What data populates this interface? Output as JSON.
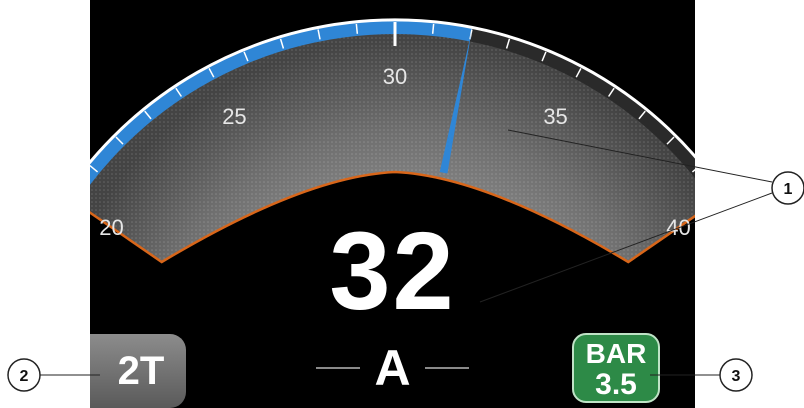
{
  "gauge": {
    "scale_min": 20,
    "scale_max": 40,
    "current_value": 32,
    "set_value": 30,
    "tick_labels": [
      "20",
      "25",
      "30",
      "35",
      "40"
    ],
    "accent_color": "#2f86d6",
    "outline_color": "#d8661a"
  },
  "display": {
    "big_value": "32",
    "mode_letter": "A"
  },
  "gear_badge": {
    "label": "2T"
  },
  "pressure_badge": {
    "line1": "BAR",
    "line2": "3.5",
    "color": "#2d8a47"
  },
  "callouts": {
    "one": "1",
    "two": "2",
    "three": "3"
  }
}
